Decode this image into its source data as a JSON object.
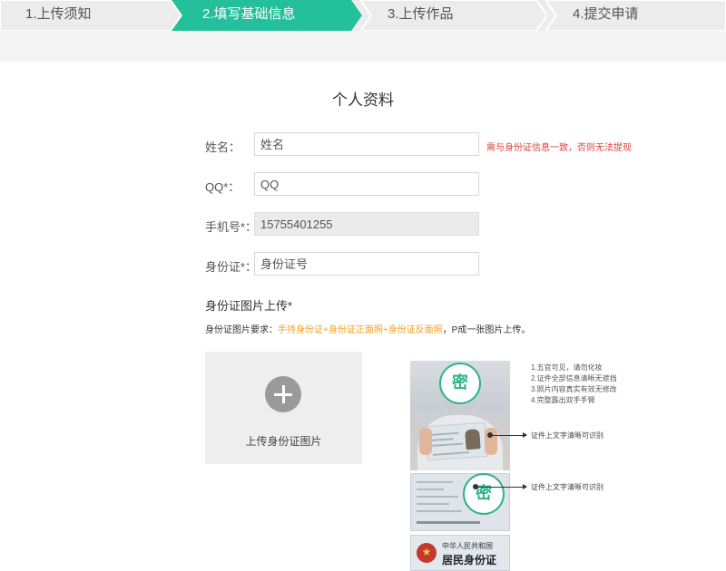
{
  "steps": [
    {
      "label": "1.上传须知",
      "active": false
    },
    {
      "label": "2.填写基础信息",
      "active": true
    },
    {
      "label": "3.上传作品",
      "active": false
    },
    {
      "label": "4.提交申请",
      "active": false
    }
  ],
  "colors": {
    "accent": "#23c09b",
    "warning": "#d9433a",
    "highlight": "#f0a020"
  },
  "form": {
    "title": "个人资料",
    "name": {
      "label": "姓名：",
      "placeholder": "姓名",
      "value": ""
    },
    "name_hint": "需与身份证信息一致，否则无法提现",
    "qq": {
      "label": "QQ*：",
      "placeholder": "QQ",
      "value": ""
    },
    "phone": {
      "label": "手机号*：",
      "value": "15755401255"
    },
    "id_number": {
      "label": "身份证*：",
      "placeholder": "身份证号",
      "value": ""
    }
  },
  "upload": {
    "title": "身份证图片上传*",
    "requirement_prefix": "身份证图片要求：",
    "requirement_highlight": "手持身份证+身份证正面照+身份证反面照",
    "requirement_suffix": "，P成一张图片上传。",
    "button_label": "上传身份证图片",
    "button_icon": "plus-icon"
  },
  "example": {
    "stamp_text": "密",
    "front_line1": "中华人民共和国",
    "front_line2": "居民身份证",
    "notes": [
      "1.五官可见，请勿化妆",
      "2.证件全部信息清晰无遮挡",
      "3.照片内容真实有效无修改",
      "4.完整露出双手手臂"
    ],
    "arrow_label_1": "证件上文字清晰可识别",
    "arrow_label_2": "证件上文字清晰可识别"
  }
}
